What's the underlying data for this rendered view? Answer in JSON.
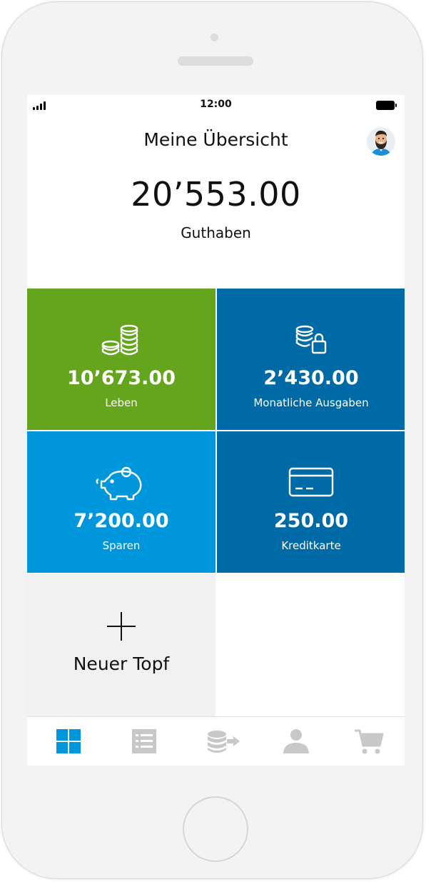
{
  "status_bar": {
    "time": "12:00"
  },
  "header": {
    "title": "Meine Übersicht",
    "avatar_icon": "avatar-icon"
  },
  "summary": {
    "balance": "20’553.00",
    "label": "Guthaben"
  },
  "tiles": [
    {
      "amount": "10’673.00",
      "label": "Leben",
      "icon": "coins-stack-icon",
      "color": "#65a51d"
    },
    {
      "amount": "2’430.00",
      "label": "Monatliche Ausgaben",
      "icon": "coins-lock-icon",
      "color": "#006aa7"
    },
    {
      "amount": "7’200.00",
      "label": "Sparen",
      "icon": "piggy-bank-icon",
      "color": "#0096dc"
    },
    {
      "amount": "250.00",
      "label": "Kreditkarte",
      "icon": "credit-card-icon",
      "color": "#006aa7"
    }
  ],
  "new_pot": {
    "label": "Neuer Topf",
    "icon": "plus-icon"
  },
  "tab_bar": {
    "active_color": "#0096dc",
    "inactive_color": "#c8c8c8",
    "tabs": [
      {
        "icon": "dashboard-grid-icon",
        "active": true
      },
      {
        "icon": "list-icon",
        "active": false
      },
      {
        "icon": "transfer-coins-icon",
        "active": false
      },
      {
        "icon": "profile-icon",
        "active": false
      },
      {
        "icon": "cart-icon",
        "active": false
      }
    ]
  }
}
